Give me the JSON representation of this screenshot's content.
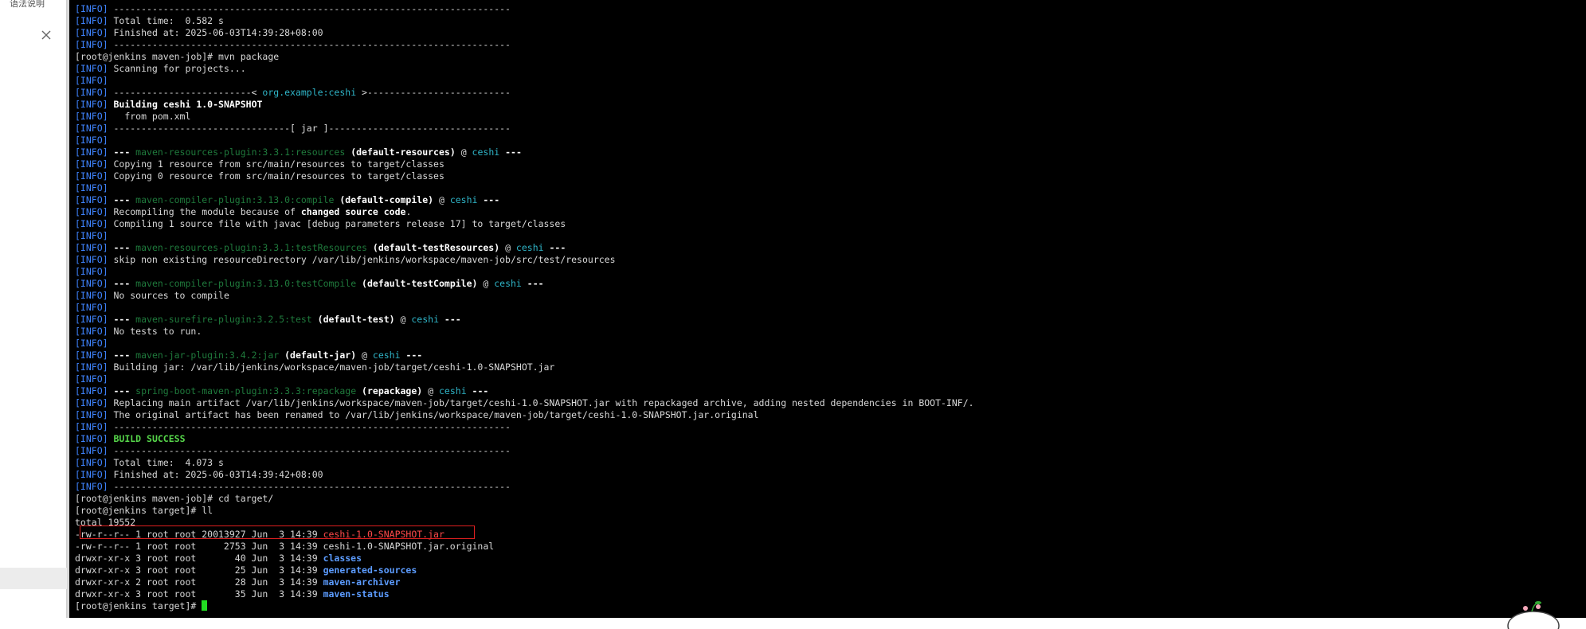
{
  "sidebar": {
    "label": "语法说明"
  },
  "terminal": {
    "lines": [
      [
        [
          "[",
          "info"
        ],
        [
          "INFO",
          "info"
        ],
        [
          "] ------------------------------------------------------------------------",
          ""
        ]
      ],
      [
        [
          "[",
          "info"
        ],
        [
          "INFO",
          "info"
        ],
        [
          "] Total time:  0.582 s",
          ""
        ]
      ],
      [
        [
          "[",
          "info"
        ],
        [
          "INFO",
          "info"
        ],
        [
          "] Finished at: 2025-06-03T14:39:28+08:00",
          ""
        ]
      ],
      [
        [
          "[",
          "info"
        ],
        [
          "INFO",
          "info"
        ],
        [
          "] ------------------------------------------------------------------------",
          ""
        ]
      ],
      [
        [
          "[root@jenkins maven-job]# mvn package",
          ""
        ]
      ],
      [
        [
          "[INFO]",
          "info"
        ],
        [
          " Scanning for projects...",
          ""
        ]
      ],
      [
        [
          "[INFO]",
          "info"
        ]
      ],
      [
        [
          "[INFO]",
          "info"
        ],
        [
          " -------------------------< ",
          ""
        ],
        [
          "org.example:ceshi",
          "cyan"
        ],
        [
          " >--------------------------",
          ""
        ]
      ],
      [
        [
          "[INFO]",
          "info"
        ],
        [
          " ",
          ""
        ],
        [
          "Building ceshi 1.0-SNAPSHOT",
          "bold"
        ]
      ],
      [
        [
          "[INFO]",
          "info"
        ],
        [
          "   from pom.xml",
          ""
        ]
      ],
      [
        [
          "[INFO]",
          "info"
        ],
        [
          " --------------------------------[ jar ]---------------------------------",
          ""
        ]
      ],
      [
        [
          "[INFO]",
          "info"
        ]
      ],
      [
        [
          "[INFO]",
          "info"
        ],
        [
          " --- ",
          "bold"
        ],
        [
          "maven-resources-plugin:3.3.1:resources",
          "green"
        ],
        [
          " (default-resources)",
          "bold"
        ],
        [
          " @ ",
          ""
        ],
        [
          "ceshi",
          "cyan"
        ],
        [
          " ---",
          "bold"
        ]
      ],
      [
        [
          "[INFO]",
          "info"
        ],
        [
          " Copying 1 resource from src/main/resources to target/classes",
          ""
        ]
      ],
      [
        [
          "[INFO]",
          "info"
        ],
        [
          " Copying 0 resource from src/main/resources to target/classes",
          ""
        ]
      ],
      [
        [
          "[INFO]",
          "info"
        ]
      ],
      [
        [
          "[INFO]",
          "info"
        ],
        [
          " --- ",
          "bold"
        ],
        [
          "maven-compiler-plugin:3.13.0:compile",
          "green"
        ],
        [
          " (default-compile)",
          "bold"
        ],
        [
          " @ ",
          ""
        ],
        [
          "ceshi",
          "cyan"
        ],
        [
          " ---",
          "bold"
        ]
      ],
      [
        [
          "[INFO]",
          "info"
        ],
        [
          " Recompiling the module because of ",
          ""
        ],
        [
          "changed source code",
          "bold"
        ],
        [
          ".",
          ""
        ]
      ],
      [
        [
          "[INFO]",
          "info"
        ],
        [
          " Compiling 1 source file with javac [debug parameters release 17] to target/classes",
          ""
        ]
      ],
      [
        [
          "[INFO]",
          "info"
        ]
      ],
      [
        [
          "[INFO]",
          "info"
        ],
        [
          " --- ",
          "bold"
        ],
        [
          "maven-resources-plugin:3.3.1:testResources",
          "green"
        ],
        [
          " (default-testResources)",
          "bold"
        ],
        [
          " @ ",
          ""
        ],
        [
          "ceshi",
          "cyan"
        ],
        [
          " ---",
          "bold"
        ]
      ],
      [
        [
          "[INFO]",
          "info"
        ],
        [
          " skip non existing resourceDirectory /var/lib/jenkins/workspace/maven-job/src/test/resources",
          ""
        ]
      ],
      [
        [
          "[INFO]",
          "info"
        ]
      ],
      [
        [
          "[INFO]",
          "info"
        ],
        [
          " --- ",
          "bold"
        ],
        [
          "maven-compiler-plugin:3.13.0:testCompile",
          "green"
        ],
        [
          " (default-testCompile)",
          "bold"
        ],
        [
          " @ ",
          ""
        ],
        [
          "ceshi",
          "cyan"
        ],
        [
          " ---",
          "bold"
        ]
      ],
      [
        [
          "[INFO]",
          "info"
        ],
        [
          " No sources to compile",
          ""
        ]
      ],
      [
        [
          "[INFO]",
          "info"
        ]
      ],
      [
        [
          "[INFO]",
          "info"
        ],
        [
          " --- ",
          "bold"
        ],
        [
          "maven-surefire-plugin:3.2.5:test",
          "green"
        ],
        [
          " (default-test)",
          "bold"
        ],
        [
          " @ ",
          ""
        ],
        [
          "ceshi",
          "cyan"
        ],
        [
          " ---",
          "bold"
        ]
      ],
      [
        [
          "[INFO]",
          "info"
        ],
        [
          " No tests to run.",
          ""
        ]
      ],
      [
        [
          "[INFO]",
          "info"
        ]
      ],
      [
        [
          "[INFO]",
          "info"
        ],
        [
          " --- ",
          "bold"
        ],
        [
          "maven-jar-plugin:3.4.2:jar",
          "green"
        ],
        [
          " (default-jar)",
          "bold"
        ],
        [
          " @ ",
          ""
        ],
        [
          "ceshi",
          "cyan"
        ],
        [
          " ---",
          "bold"
        ]
      ],
      [
        [
          "[INFO]",
          "info"
        ],
        [
          " Building jar: /var/lib/jenkins/workspace/maven-job/target/ceshi-1.0-SNAPSHOT.jar",
          ""
        ]
      ],
      [
        [
          "[INFO]",
          "info"
        ]
      ],
      [
        [
          "[INFO]",
          "info"
        ],
        [
          " --- ",
          "bold"
        ],
        [
          "spring-boot-maven-plugin:3.3.3:repackage",
          "green"
        ],
        [
          " (repackage)",
          "bold"
        ],
        [
          " @ ",
          ""
        ],
        [
          "ceshi",
          "cyan"
        ],
        [
          " ---",
          "bold"
        ]
      ],
      [
        [
          "[INFO]",
          "info"
        ],
        [
          " Replacing main artifact /var/lib/jenkins/workspace/maven-job/target/ceshi-1.0-SNAPSHOT.jar with repackaged archive, adding nested dependencies in BOOT-INF/.",
          ""
        ]
      ],
      [
        [
          "[INFO]",
          "info"
        ],
        [
          " The original artifact has been renamed to /var/lib/jenkins/workspace/maven-job/target/ceshi-1.0-SNAPSHOT.jar.original",
          ""
        ]
      ],
      [
        [
          "[INFO]",
          "info"
        ],
        [
          " ------------------------------------------------------------------------",
          ""
        ]
      ],
      [
        [
          "[INFO]",
          "info"
        ],
        [
          " ",
          ""
        ],
        [
          "BUILD SUCCESS",
          "success"
        ]
      ],
      [
        [
          "[INFO]",
          "info"
        ],
        [
          " ------------------------------------------------------------------------",
          ""
        ]
      ],
      [
        [
          "[INFO]",
          "info"
        ],
        [
          " Total time:  4.073 s",
          ""
        ]
      ],
      [
        [
          "[INFO]",
          "info"
        ],
        [
          " Finished at: 2025-06-03T14:39:42+08:00",
          ""
        ]
      ],
      [
        [
          "[INFO]",
          "info"
        ],
        [
          " ------------------------------------------------------------------------",
          ""
        ]
      ],
      [
        [
          "[root@jenkins maven-job]# cd target/",
          ""
        ]
      ],
      [
        [
          "[root@jenkins target]# ll",
          ""
        ]
      ],
      [
        [
          "total 19552",
          ""
        ]
      ],
      [
        [
          "-rw-r--r-- 1 root root 20013927 Jun  3 14:39 ",
          ""
        ],
        [
          "ceshi-1.0-SNAPSHOT.jar",
          "jar"
        ]
      ],
      [
        [
          "-rw-r--r-- 1 root root     2753 Jun  3 14:39 ceshi-1.0-SNAPSHOT.jar.original",
          ""
        ]
      ],
      [
        [
          "drwxr-xr-x 3 root root       40 Jun  3 14:39 ",
          ""
        ],
        [
          "classes",
          "dir"
        ]
      ],
      [
        [
          "drwxr-xr-x 3 root root       25 Jun  3 14:39 ",
          ""
        ],
        [
          "generated-sources",
          "dir"
        ]
      ],
      [
        [
          "drwxr-xr-x 2 root root       28 Jun  3 14:39 ",
          ""
        ],
        [
          "maven-archiver",
          "dir"
        ]
      ],
      [
        [
          "drwxr-xr-x 3 root root       35 Jun  3 14:39 ",
          ""
        ],
        [
          "maven-status",
          "dir"
        ]
      ],
      [
        [
          "[root@jenkins target]# ",
          ""
        ]
      ]
    ],
    "cursor_color": "#22dd22",
    "highlight_color": "#e02020"
  },
  "colors": {
    "info": "#3f84ff",
    "cyan": "#2fb5c8",
    "plugin_green": "#1f7a3c",
    "success": "#56d64a",
    "jar_red": "#ff4a4a",
    "dir_blue": "#5c9cff"
  }
}
